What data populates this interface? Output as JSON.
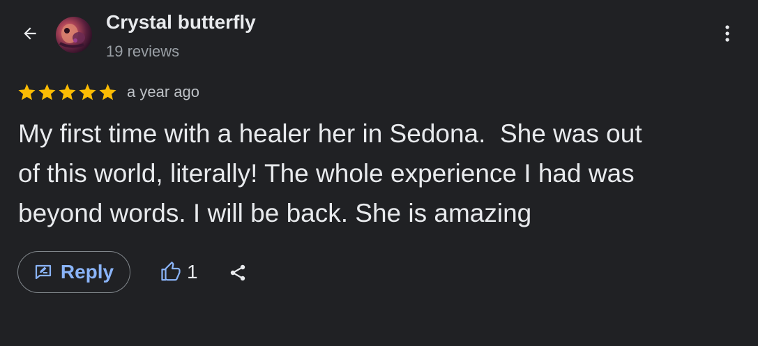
{
  "header": {
    "back_icon": "arrow-back-icon",
    "author_name": "Crystal butterfly",
    "review_count": "19 reviews",
    "more_icon": "more-vert-icon"
  },
  "review": {
    "stars": 5,
    "star_color": "#fbbc04",
    "time_ago": "a year ago",
    "text": "My first time with a healer her in Sedona.  She was out\nof this world, literally! The whole experience I had was\nbeyond words. I will be back. She is amazing"
  },
  "actions": {
    "reply_label": "Reply",
    "reply_icon": "rate-review-icon",
    "like_icon": "thumb-up-icon",
    "like_count": "1",
    "share_icon": "share-icon"
  },
  "colors": {
    "background": "#202124",
    "accent": "#8ab4f8",
    "text_primary": "#e8eaed",
    "text_secondary": "#9aa0a6"
  }
}
